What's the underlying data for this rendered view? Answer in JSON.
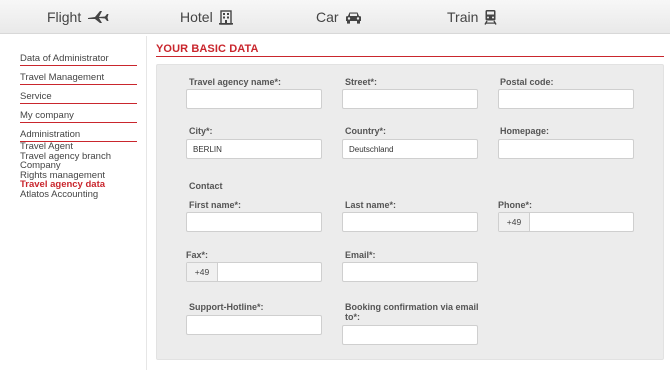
{
  "nav": {
    "flight": "Flight",
    "hotel": "Hotel",
    "car": "Car",
    "train": "Train"
  },
  "sidebar": {
    "sections": [
      {
        "label": "Data of Administrator"
      },
      {
        "label": "Travel Management"
      },
      {
        "label": "Service"
      },
      {
        "label": "My company"
      },
      {
        "label": "Administration"
      }
    ],
    "items": [
      {
        "label": "Travel Agent",
        "active": false
      },
      {
        "label": "Travel agency branch",
        "active": false
      },
      {
        "label": "Company",
        "active": false
      },
      {
        "label": "Rights management",
        "active": false
      },
      {
        "label": "Travel agency data",
        "active": true
      },
      {
        "label": "Atlatos Accounting",
        "active": false
      }
    ]
  },
  "main": {
    "title": "YOUR BASIC DATA",
    "fields": {
      "agency_name": {
        "label": "Travel agency name*:",
        "value": ""
      },
      "street": {
        "label": "Street*:",
        "value": ""
      },
      "postal_code": {
        "label": "Postal code:",
        "value": ""
      },
      "city": {
        "label": "City*:",
        "value": "BERLIN"
      },
      "country": {
        "label": "Country*:",
        "value": "Deutschland"
      },
      "homepage": {
        "label": "Homepage:",
        "value": ""
      },
      "contact_heading": "Contact",
      "first_name": {
        "label": "First name*:",
        "value": ""
      },
      "last_name": {
        "label": "Last name*:",
        "value": ""
      },
      "phone": {
        "label": "Phone*:",
        "prefix": "+49",
        "value": ""
      },
      "fax": {
        "label": "Fax*:",
        "prefix": "+49",
        "value": ""
      },
      "email": {
        "label": "Email*:",
        "value": ""
      },
      "support_hotline": {
        "label": "Support-Hotline*:",
        "value": ""
      },
      "booking_email": {
        "label": "Booking confirmation via email to*:",
        "value": ""
      }
    }
  },
  "colors": {
    "accent": "#c9262d",
    "panel": "#ececec"
  }
}
